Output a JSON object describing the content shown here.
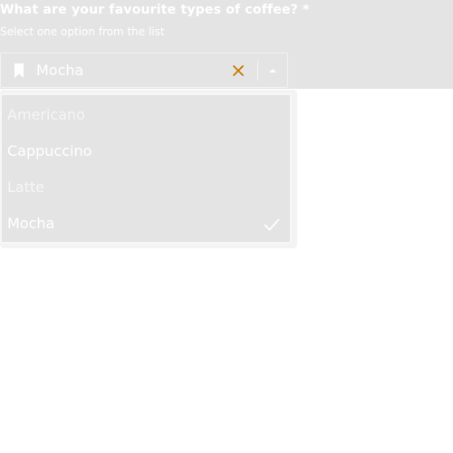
{
  "question": {
    "label": "What are your favourite types of coffee? *",
    "helper": "Select one option from the list"
  },
  "select": {
    "value": "Mocha",
    "icons": {
      "leading": "bookmark-icon",
      "clear": "close-icon",
      "toggle": "caret-up-icon"
    },
    "clear_icon_color": "#f0a000",
    "options": [
      {
        "label": "Americano",
        "selected": false
      },
      {
        "label": "Cappuccino",
        "selected": false
      },
      {
        "label": "Latte",
        "selected": false
      },
      {
        "label": "Mocha",
        "selected": true
      }
    ]
  }
}
